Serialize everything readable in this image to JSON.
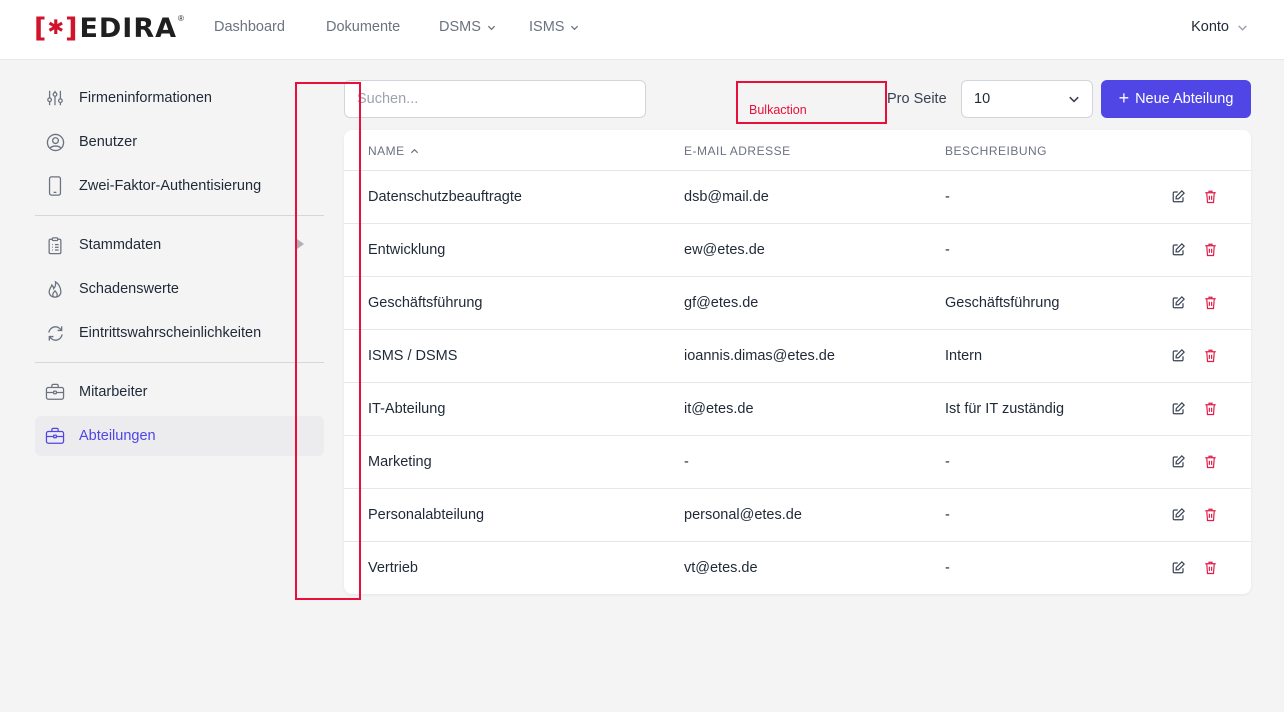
{
  "brand": {
    "bracket_left": "[",
    "bracket_right": "]",
    "name": "EDIRA",
    "registered": "®"
  },
  "nav": {
    "items": [
      {
        "label": "Dashboard"
      },
      {
        "label": "Dokumente"
      },
      {
        "label": "DSMS"
      },
      {
        "label": "ISMS"
      }
    ],
    "account": "Konto"
  },
  "sidebar": {
    "items": [
      {
        "label": "Firmeninformationen",
        "icon": "sliders-icon"
      },
      {
        "label": "Benutzer",
        "icon": "user-circle-icon"
      },
      {
        "label": "Zwei-Faktor-Authentisierung",
        "icon": "smartphone-icon"
      },
      {
        "label": "Stammdaten",
        "icon": "clipboard-list-icon"
      },
      {
        "label": "Schadenswerte",
        "icon": "fire-icon"
      },
      {
        "label": "Eintrittswahrscheinlichkeiten",
        "icon": "refresh-icon"
      },
      {
        "label": "Mitarbeiter",
        "icon": "briefcase-icon"
      },
      {
        "label": "Abteilungen",
        "icon": "briefcase-icon",
        "active": true
      }
    ]
  },
  "toolbar": {
    "search_placeholder": "Suchen...",
    "bulk_label": "Bulkaction",
    "per_page_label": "Pro Seite",
    "per_page_value": "10",
    "new_button": "Neue Abteilung"
  },
  "table": {
    "columns": [
      "Name",
      "E-Mail Adresse",
      "Beschreibung"
    ],
    "rows": [
      {
        "name": "Datenschutzbeauftragte",
        "email": "dsb@mail.de",
        "description": "-"
      },
      {
        "name": "Entwicklung",
        "email": "ew@etes.de",
        "description": "-"
      },
      {
        "name": "Geschäftsführung",
        "email": "gf@etes.de",
        "description": "Geschäftsführung"
      },
      {
        "name": "ISMS / DSMS",
        "email": "ioannis.dimas@etes.de",
        "description": "Intern"
      },
      {
        "name": "IT-Abteilung",
        "email": "it@etes.de",
        "description": "Ist für IT zuständig"
      },
      {
        "name": "Marketing",
        "email": "-",
        "description": "-"
      },
      {
        "name": "Personalabteilung",
        "email": "personal@etes.de",
        "description": "-"
      },
      {
        "name": "Vertrieb",
        "email": "vt@etes.de",
        "description": "-"
      }
    ]
  },
  "colors": {
    "accent": "#4f46e5",
    "brand_red": "#d0142c",
    "delete_red": "#e11d48",
    "annotation_red": "#e8103a"
  }
}
